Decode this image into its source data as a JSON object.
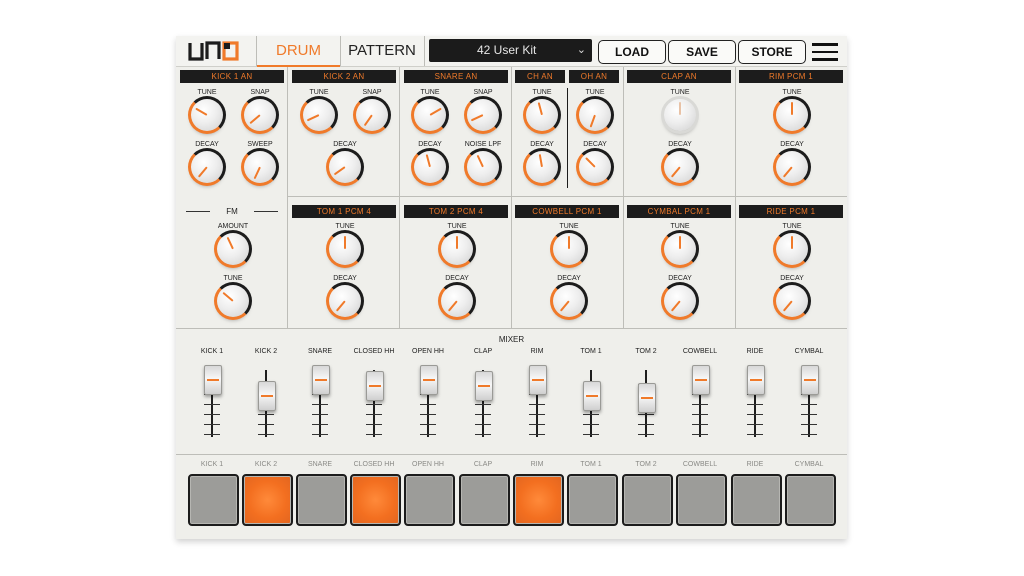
{
  "header": {
    "logo": "UNO",
    "tabs": [
      "DRUM",
      "PATTERN"
    ],
    "kit_select": "42 User Kit",
    "buttons": [
      "LOAD",
      "SAVE",
      "STORE"
    ]
  },
  "colors": {
    "accent": "#f07a2a",
    "dark": "#1c1c1c",
    "panel": "#efefeb"
  },
  "sections": {
    "kick1": {
      "title": "KICK 1 AN",
      "knobs": [
        "TUNE",
        "SNAP",
        "DECAY",
        "SWEEP"
      ]
    },
    "kick2": {
      "title": "KICK 2 AN",
      "knobs": [
        "TUNE",
        "SNAP",
        "DECAY"
      ]
    },
    "snare": {
      "title": "SNARE AN",
      "knobs": [
        "TUNE",
        "SNAP",
        "DECAY",
        "NOISE LPF"
      ]
    },
    "ch": {
      "title": "CH AN",
      "knobs": [
        "TUNE",
        "DECAY"
      ]
    },
    "oh": {
      "title": "OH AN",
      "knobs": [
        "TUNE",
        "DECAY"
      ]
    },
    "clap": {
      "title": "CLAP AN",
      "knobs": [
        "TUNE",
        "DECAY"
      ]
    },
    "rim": {
      "title": "RIM PCM 1",
      "knobs": [
        "TUNE",
        "DECAY"
      ]
    },
    "fm": {
      "title": "FM",
      "knobs": [
        "AMOUNT",
        "TUNE"
      ]
    },
    "tom1": {
      "title": "TOM 1 PCM 4",
      "knobs": [
        "TUNE",
        "DECAY"
      ]
    },
    "tom2": {
      "title": "TOM 2 PCM 4",
      "knobs": [
        "TUNE",
        "DECAY"
      ]
    },
    "cowbell": {
      "title": "COWBELL PCM 1",
      "knobs": [
        "TUNE",
        "DECAY"
      ]
    },
    "cymbal": {
      "title": "CYMBAL PCM 1",
      "knobs": [
        "TUNE",
        "DECAY"
      ]
    },
    "ride": {
      "title": "RIDE PCM 1",
      "knobs": [
        "TUNE",
        "DECAY"
      ]
    }
  },
  "mixer": {
    "title": "MIXER",
    "channels": [
      "KICK 1",
      "KICK 2",
      "SNARE",
      "CLOSED HH",
      "OPEN HH",
      "CLAP",
      "RIM",
      "TOM 1",
      "TOM 2",
      "COWBELL",
      "RIDE",
      "CYMBAL"
    ],
    "levels": [
      0.92,
      0.55,
      0.92,
      0.8,
      0.92,
      0.8,
      0.92,
      0.55,
      0.52,
      0.92,
      0.92,
      0.92
    ]
  },
  "pads": {
    "labels": [
      "KICK 1",
      "KICK 2",
      "SNARE",
      "CLOSED HH",
      "OPEN HH",
      "CLAP",
      "RIM",
      "TOM 1",
      "TOM 2",
      "COWBELL",
      "RIDE",
      "CYMBAL"
    ],
    "active": [
      false,
      true,
      false,
      true,
      false,
      false,
      true,
      false,
      false,
      false,
      false,
      false
    ]
  }
}
